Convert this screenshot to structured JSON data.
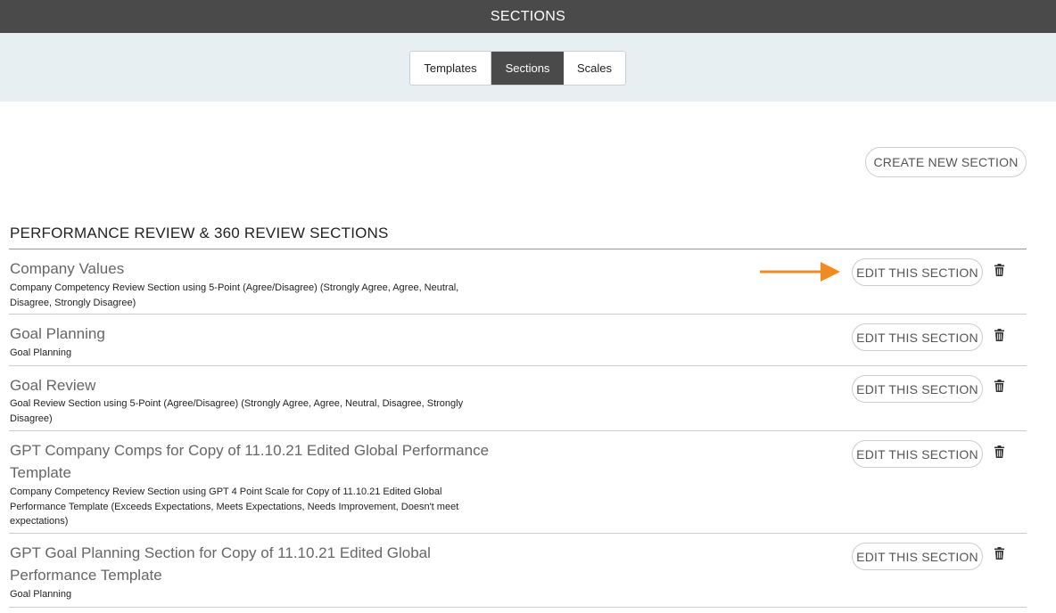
{
  "header": {
    "title": "SECTIONS"
  },
  "tabs": [
    {
      "label": "Templates",
      "active": false
    },
    {
      "label": "Sections",
      "active": true
    },
    {
      "label": "Scales",
      "active": false
    }
  ],
  "actions": {
    "create_label": "CREATE NEW SECTION"
  },
  "list": {
    "heading": "PERFORMANCE REVIEW & 360 REVIEW SECTIONS",
    "edit_label": "EDIT THIS SECTION",
    "rows": [
      {
        "title": "Company Values",
        "description": "Company Competency Review Section using 5-Point (Agree/Disagree) (Strongly Agree, Agree, Neutral, Disagree, Strongly Disagree)"
      },
      {
        "title": "Goal Planning",
        "description": "Goal Planning"
      },
      {
        "title": "Goal Review",
        "description": "Goal Review Section using 5-Point (Agree/Disagree) (Strongly Agree, Agree, Neutral, Disagree, Strongly Disagree)"
      },
      {
        "title": "GPT Company Comps for Copy of 11.10.21 Edited Global Performance Template",
        "description": "Company Competency Review Section using GPT 4 Point Scale for Copy of 11.10.21 Edited Global Performance Template (Exceeds Expectations, Meets Expectations, Needs Improvement, Doesn't meet expectations)"
      },
      {
        "title": "GPT Goal Planning Section for Copy of 11.10.21 Edited Global Performance Template",
        "description": "Goal Planning"
      }
    ]
  },
  "icons": {
    "delete": "trash-icon",
    "pointer": "arrow-right-icon"
  },
  "colors": {
    "header_bg": "#4a4a4a",
    "tab_band_bg": "#e8eff2",
    "accent_arrow": "#f08a24"
  }
}
